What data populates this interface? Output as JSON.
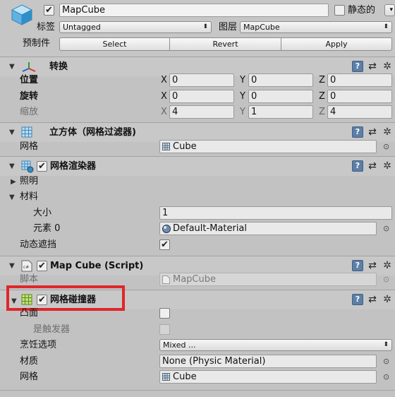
{
  "header": {
    "object_name": "MapCube",
    "active_checked": true,
    "static_label": "静态的",
    "static_checked": false,
    "tag_label": "标签",
    "tag_value": "Untagged",
    "layer_label": "图层",
    "layer_value": "MapCube",
    "prefab_label": "预制件",
    "select_label": "Select",
    "revert_label": "Revert",
    "apply_label": "Apply"
  },
  "transform": {
    "title": "转换",
    "position_label": "位置",
    "rotation_label": "旋转",
    "scale_label": "缩放",
    "axis_x": "X",
    "axis_y": "Y",
    "axis_z": "Z",
    "position": {
      "x": "0",
      "y": "0",
      "z": "0"
    },
    "rotation": {
      "x": "0",
      "y": "0",
      "z": "0"
    },
    "scale": {
      "x": "4",
      "y": "1",
      "z": "4"
    }
  },
  "mesh_filter": {
    "title": "立方体（网格过滤器)",
    "mesh_label": "网格",
    "mesh_value": "Cube"
  },
  "mesh_renderer": {
    "title": "网格渲染器",
    "enabled": true,
    "lighting_label": "照明",
    "materials_label": "材料",
    "size_label": "大小",
    "size_value": "1",
    "element_label": "元素 0",
    "element_value": "Default-Material",
    "dynamic_occlusion_label": "动态遮挡",
    "dynamic_occlusion_checked": true
  },
  "script": {
    "title": "Map Cube (Script)",
    "enabled": true,
    "script_label": "脚本",
    "script_value": "MapCube"
  },
  "mesh_collider": {
    "title": "网格碰撞器",
    "enabled": true,
    "convex_label": "凸面",
    "convex_checked": false,
    "trigger_label": "是触发器",
    "trigger_checked": false,
    "cooking_label": "烹饪选项",
    "cooking_value": "Mixed ...",
    "material_label": "材质",
    "material_value": "None (Physic Material)",
    "mesh_label": "网格",
    "mesh_value": "Cube"
  },
  "icons": {
    "cube": "cube-icon",
    "help": "help-icon",
    "preset": "preset-icon",
    "gear": "gear-icon",
    "object_picker": "object-picker-icon",
    "checkmark": "✔",
    "help_glyph": "?",
    "preset_glyph": "⇄",
    "gear_glyph": "✲",
    "picker_glyph": "⊙",
    "dropdown_glyph": "⬍"
  },
  "colors": {
    "highlight": "#e0262a",
    "background": "#c2c2c2"
  }
}
